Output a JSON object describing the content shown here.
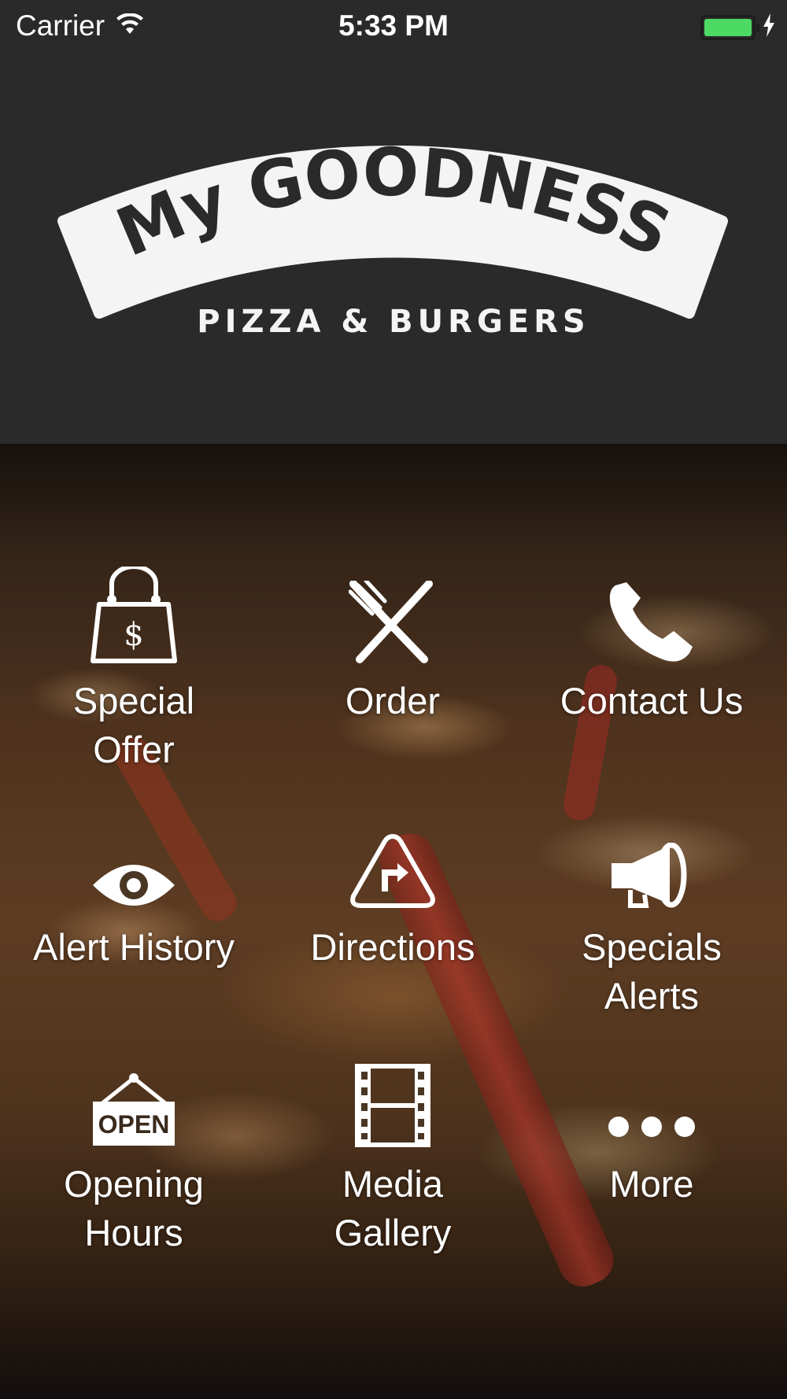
{
  "status_bar": {
    "carrier": "Carrier",
    "time": "5:33 PM",
    "battery_color": "#4cd964"
  },
  "header": {
    "logo_title": "My GOODNESS",
    "tagline": "PIZZA & BURGERS",
    "background_color": "#2a2a2a"
  },
  "menu": {
    "items": [
      {
        "label": "Special\nOffer",
        "icon": "shopping-bag-dollar-icon"
      },
      {
        "label": "Order",
        "icon": "fork-knife-icon"
      },
      {
        "label": "Contact Us",
        "icon": "phone-icon"
      },
      {
        "label": "Alert History",
        "icon": "eye-icon"
      },
      {
        "label": "Directions",
        "icon": "directions-sign-icon"
      },
      {
        "label": "Specials\nAlerts",
        "icon": "megaphone-icon"
      },
      {
        "label": "Opening\nHours",
        "icon": "open-sign-icon"
      },
      {
        "label": "Media\nGallery",
        "icon": "film-strip-icon"
      },
      {
        "label": "More",
        "icon": "more-dots-icon"
      }
    ]
  }
}
